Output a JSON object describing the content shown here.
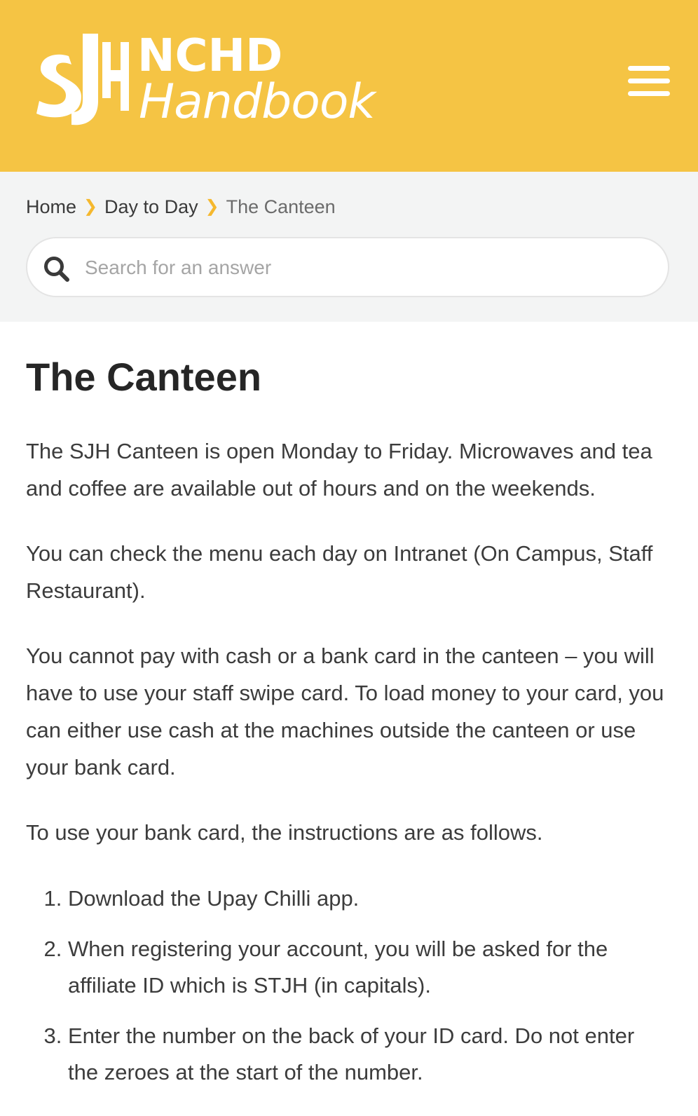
{
  "header": {
    "logo_text_top": "NCHD",
    "logo_text_bottom": "Handbook",
    "logo_mark": "SJH",
    "background_color": "#f5c444",
    "menu_icon": "hamburger-menu-icon"
  },
  "breadcrumb": {
    "items": [
      {
        "label": "Home"
      },
      {
        "label": "Day to Day"
      }
    ],
    "current": "The Canteen",
    "separator_icon": "chevron-right-icon"
  },
  "search": {
    "placeholder": "Search for an answer",
    "value": "",
    "icon": "search-icon"
  },
  "article": {
    "title": "The Canteen",
    "paragraphs": [
      "The SJH Canteen is open Monday to Friday. Microwaves and tea and coffee are available out of hours and on the weekends.",
      "You can check the menu each day on Intranet (On Campus, Staff Restaurant).",
      "You cannot pay with cash or a bank card in the canteen – you will have to use your staff swipe card. To load money to your card, you can either use cash at the machines outside the canteen or use your bank card.",
      "To use your bank card, the instructions are as follows."
    ],
    "steps": [
      "Download the Upay Chilli app.",
      "When registering your account, you will be asked for the affiliate ID which is STJH (in capitals).",
      "Enter the number on the back of your ID card. Do not enter the zeroes at the start of the number."
    ]
  }
}
